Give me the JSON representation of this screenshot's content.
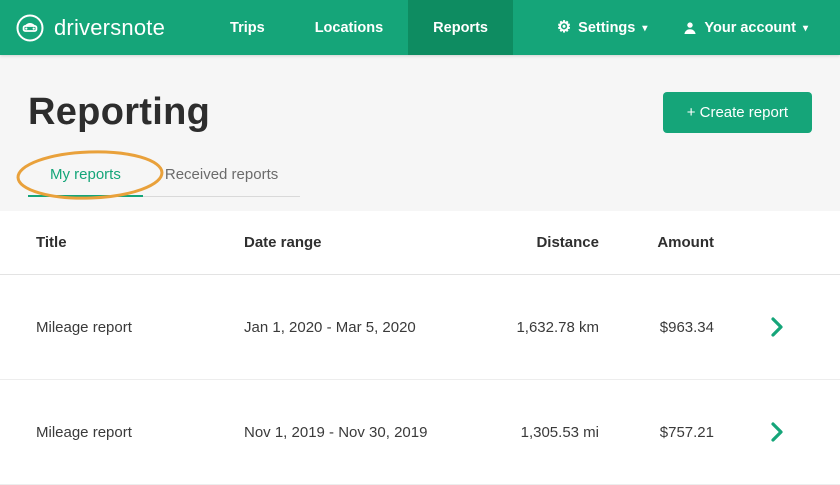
{
  "navbar": {
    "brand": "driversnote",
    "items": [
      {
        "label": "Trips",
        "active": false
      },
      {
        "label": "Locations",
        "active": false
      },
      {
        "label": "Reports",
        "active": true
      }
    ],
    "settings": {
      "label": "Settings"
    },
    "account": {
      "label": "Your account"
    }
  },
  "icons": {
    "gear": "⚙",
    "caret_down": "▾"
  },
  "page": {
    "title": "Reporting",
    "create_report_button": "+ Create report"
  },
  "tabs": [
    {
      "label": "My reports",
      "active": true
    },
    {
      "label": "Received reports",
      "active": false
    }
  ],
  "table": {
    "headers": [
      "Title",
      "Date range",
      "Distance",
      "Amount"
    ],
    "rows": [
      {
        "title": "Mileage report",
        "date_range": "Jan 1, 2020 - Mar 5, 2020",
        "distance": "1,632.78 km",
        "amount": "$963.34"
      },
      {
        "title": "Mileage report",
        "date_range": "Nov 1, 2019 - Nov 30, 2019",
        "distance": "1,305.53 mi",
        "amount": "$757.21"
      }
    ]
  },
  "colors": {
    "brand_green": "#15a579",
    "nav_active": "#0e8c61",
    "annotation_orange": "#e9a13b"
  }
}
